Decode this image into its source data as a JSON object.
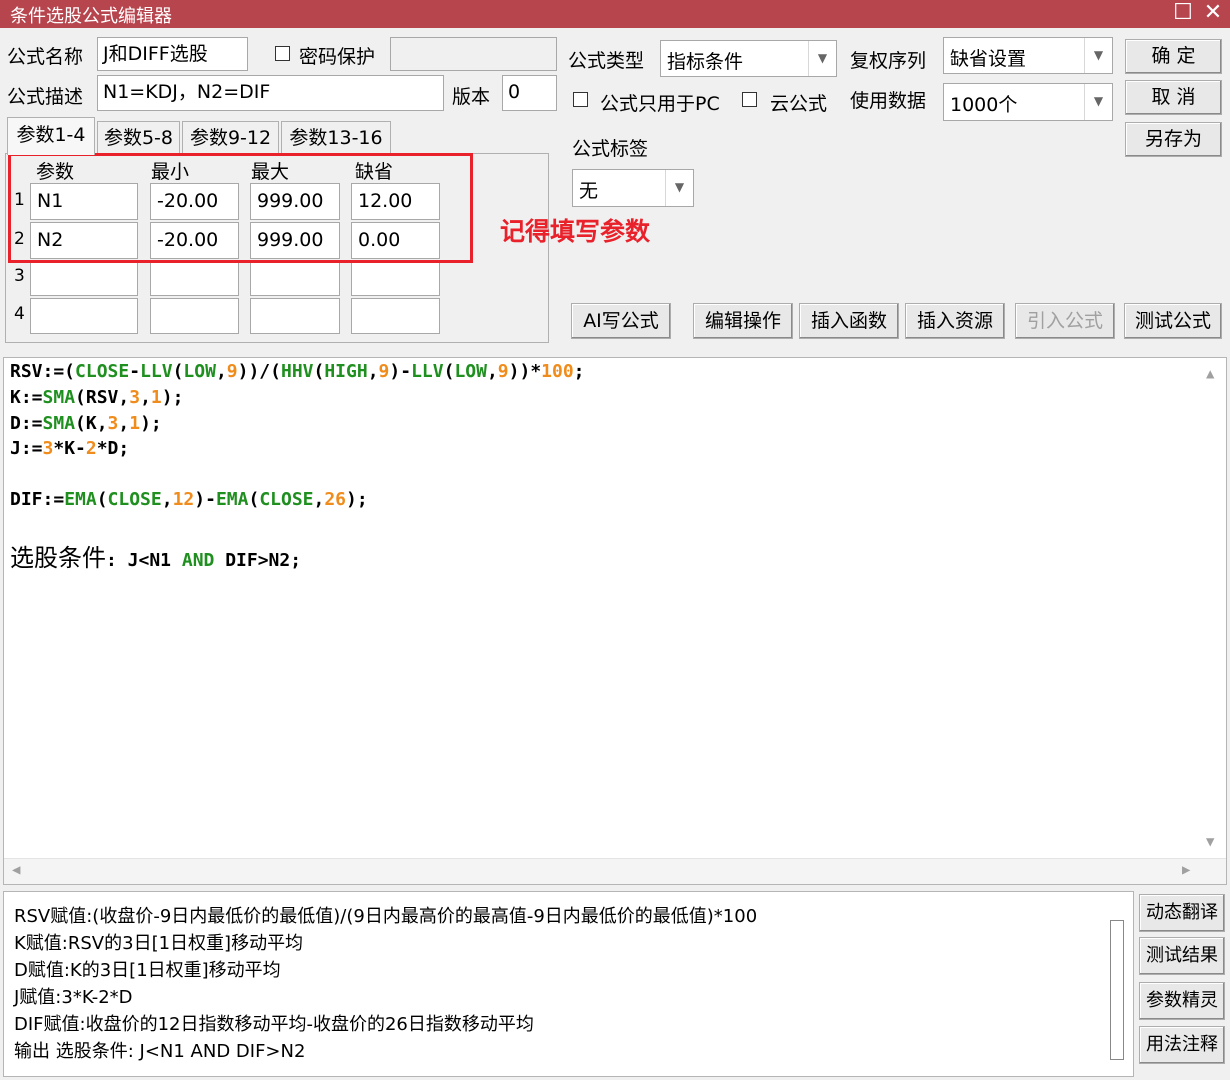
{
  "window": {
    "title": "条件选股公式编辑器",
    "maximize_glyph": "☐",
    "close_glyph": "✕"
  },
  "form": {
    "name_label": "公式名称",
    "name_value": "J和DIFF选股",
    "password_label": "密码保护",
    "desc_label": "公式描述",
    "desc_value": "N1=KDJ，N2=DIF",
    "version_label": "版本",
    "version_value": "0",
    "type_label": "公式类型",
    "type_value": "指标条件",
    "fq_label": "复权序列",
    "fq_value": "缺省设置",
    "pc_only_label": "公式只用于PC",
    "cloud_label": "云公式",
    "usedata_label": "使用数据",
    "usedata_value": "1000个",
    "tag_label": "公式标签",
    "tag_value": "无"
  },
  "buttons": {
    "ok": "确  定",
    "cancel": "取  消",
    "save_as": "另存为",
    "ai_write": "AI写公式",
    "edit_ops": "编辑操作",
    "insert_func": "插入函数",
    "insert_res": "插入资源",
    "import_formula": "引入公式",
    "test_formula": "测试公式",
    "dynamic_translate": "动态翻译",
    "test_results": "测试结果",
    "param_wizard": "参数精灵",
    "usage_notes": "用法注释"
  },
  "tabs": [
    "参数1-4",
    "参数5-8",
    "参数9-12",
    "参数13-16"
  ],
  "params": {
    "headers": [
      "参数",
      "最小",
      "最大",
      "缺省"
    ],
    "rows": [
      {
        "idx": "1",
        "name": "N1",
        "min": "-20.00",
        "max": "999.00",
        "def": "12.00"
      },
      {
        "idx": "2",
        "name": "N2",
        "min": "-20.00",
        "max": "999.00",
        "def": "0.00"
      },
      {
        "idx": "3",
        "name": "",
        "min": "",
        "max": "",
        "def": ""
      },
      {
        "idx": "4",
        "name": "",
        "min": "",
        "max": "",
        "def": ""
      }
    ]
  },
  "annotation": "记得填写参数",
  "code_lines": [
    "RSV:=(CLOSE-LLV(LOW,9))/(HHV(HIGH,9)-LLV(LOW,9))*100;",
    "K:=SMA(RSV,3,1);",
    "D:=SMA(K,3,1);",
    "J:=3*K-2*D;",
    "",
    "DIF:=EMA(CLOSE,12)-EMA(CLOSE,26);",
    "",
    "选股条件: J<N1 AND DIF>N2;"
  ],
  "translation_lines": [
    "RSV赋值:(收盘价-9日内最低价的最低值)/(9日内最高价的最高值-9日内最低价的最低值)*100",
    "K赋值:RSV的3日[1日权重]移动平均",
    "D赋值:K的3日[1日权重]移动平均",
    "J赋值:3*K-2*D",
    "DIF赋值:收盘价的12日指数移动平均-收盘价的26日指数移动平均",
    "输出  选股条件: J<N1 AND DIF>N2"
  ],
  "colors": {
    "title_bar": "#b7454e",
    "highlight": "#e8212b",
    "code_green": "#1f8f1f",
    "code_orange": "#f08c1c"
  }
}
